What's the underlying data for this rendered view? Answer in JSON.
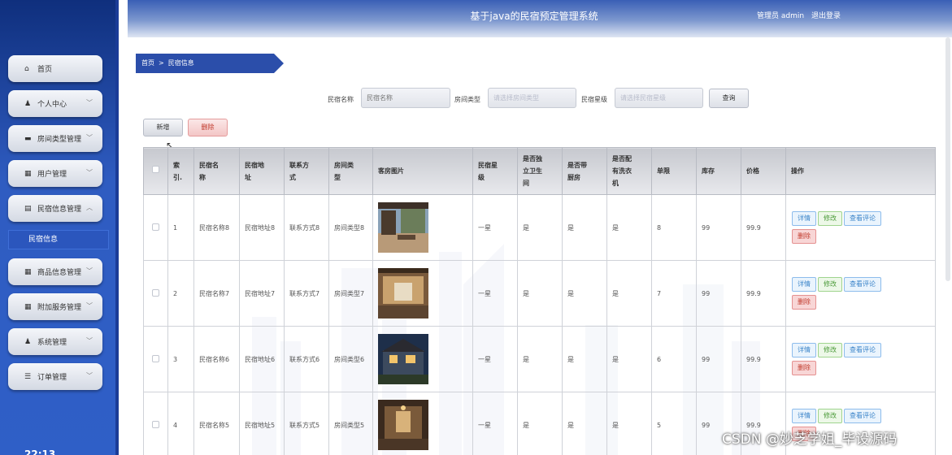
{
  "header": {
    "title": "基于java的民宿预定管理系统",
    "user": "管理员 admin",
    "logout": "退出登录"
  },
  "sidebar": {
    "items": [
      {
        "label": "首页",
        "icon": "home-icon",
        "glyph": "⌂",
        "chevron": false
      },
      {
        "label": "个人中心",
        "icon": "user-icon",
        "glyph": "♟",
        "chevron": true
      },
      {
        "label": "房间类型管理",
        "icon": "category-icon",
        "glyph": "▬",
        "chevron": true
      },
      {
        "label": "用户管理",
        "icon": "grid-icon",
        "glyph": "▦",
        "chevron": true
      },
      {
        "label": "民宿信息管理",
        "icon": "clipboard-icon",
        "glyph": "▤",
        "chevron": true,
        "expanded": true
      },
      {
        "label": "商品信息管理",
        "icon": "grid-icon",
        "glyph": "▦",
        "chevron": true
      },
      {
        "label": "附加服务管理",
        "icon": "grid-icon",
        "glyph": "▦",
        "chevron": true
      },
      {
        "label": "系统管理",
        "icon": "user-icon",
        "glyph": "♟",
        "chevron": true
      },
      {
        "label": "订单管理",
        "icon": "list-icon",
        "glyph": "☰",
        "chevron": true
      }
    ],
    "subitem": "民宿信息",
    "footer_text": "22:13"
  },
  "breadcrumb": {
    "home": "首页",
    "sep": ">",
    "current": "民宿信息"
  },
  "search": {
    "name_label": "民宿名称",
    "name_placeholder": "民宿名称",
    "type_label": "房间类型",
    "type_placeholder": "请选择房间类型",
    "star_label": "民宿星级",
    "star_placeholder": "请选择民宿星级",
    "button": "查询"
  },
  "actions": {
    "add": "新增",
    "delete": "删除"
  },
  "table": {
    "headers": [
      "",
      "索引",
      "民宿名称",
      "民宿地址",
      "联系方式",
      "房间类型",
      "客房图片",
      "民宿星级",
      "是否独立卫生间",
      "是否带厨房",
      "是否配有洗衣机",
      "单限",
      "库存",
      "价格",
      "操作"
    ],
    "header_lines": {
      "index": [
        "索",
        "引."
      ],
      "name": [
        "民宿名",
        "称"
      ],
      "addr": [
        "民宿地",
        "址"
      ],
      "contact": [
        "联系方",
        "式"
      ],
      "type": [
        "房间类",
        "型"
      ],
      "star": [
        "民宿星",
        "级"
      ],
      "bath": [
        "是否独",
        "立卫生",
        "间"
      ],
      "kitchen": [
        "是否带",
        "厨房"
      ],
      "washer": [
        "是否配",
        "有洗衣",
        "机"
      ]
    },
    "rows": [
      {
        "index": "1",
        "name": "民宿名称8",
        "address": "民宿地址8",
        "contact": "联系方式8",
        "type": "房间类型8",
        "star": "一星",
        "bath": "是",
        "kitchen": "是",
        "washer": "是",
        "limit": "8",
        "stock": "99",
        "price": "99.9"
      },
      {
        "index": "2",
        "name": "民宿名称7",
        "address": "民宿地址7",
        "contact": "联系方式7",
        "type": "房间类型7",
        "star": "一星",
        "bath": "是",
        "kitchen": "是",
        "washer": "是",
        "limit": "7",
        "stock": "99",
        "price": "99.9"
      },
      {
        "index": "3",
        "name": "民宿名称6",
        "address": "民宿地址6",
        "contact": "联系方式6",
        "type": "房间类型6",
        "star": "一星",
        "bath": "是",
        "kitchen": "是",
        "washer": "是",
        "limit": "6",
        "stock": "99",
        "price": "99.9"
      },
      {
        "index": "4",
        "name": "民宿名称5",
        "address": "民宿地址5",
        "contact": "联系方式5",
        "type": "房间类型5",
        "star": "一星",
        "bath": "是",
        "kitchen": "是",
        "washer": "是",
        "limit": "5",
        "stock": "99",
        "price": "99.9"
      }
    ],
    "ops": {
      "detail": "详情",
      "edit": "修改",
      "review": "查看评论",
      "delete": "删除"
    }
  },
  "watermark": "CSDN @妙芝学姐_毕设源码",
  "colors": {
    "sidebar": "#2f5cc1",
    "header": "#3a5fb5",
    "breadcrumb": "#2b4eaa",
    "danger": "#c0392b",
    "accent": "#3b84c9"
  }
}
